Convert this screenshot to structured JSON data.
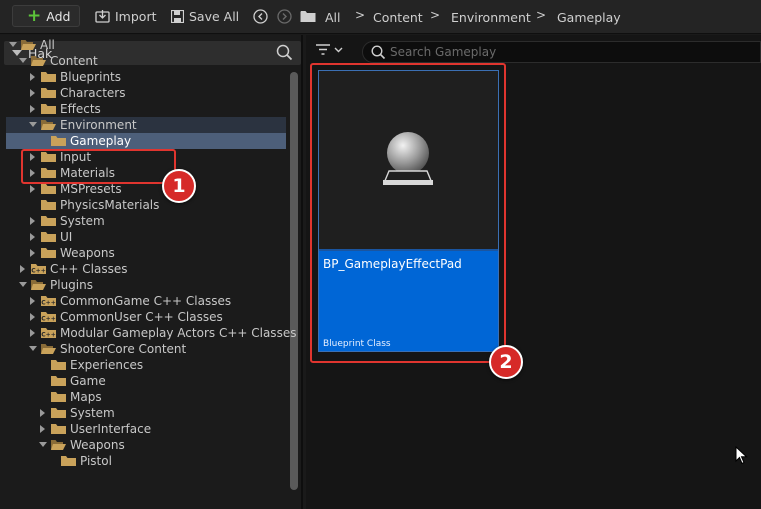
{
  "toolbar": {
    "add_label": "Add",
    "import_label": "Import",
    "save_all_label": "Save All",
    "breadcrumbs": [
      "All",
      "Content",
      "Environment",
      "Gameplay"
    ]
  },
  "sources_panel": {
    "title": "Hak",
    "tree": [
      {
        "label": "All",
        "expanded": true,
        "icon": "folder-open-icon"
      },
      {
        "label": "Content",
        "expanded": true,
        "icon": "folder-open-icon"
      },
      {
        "label": "Blueprints",
        "expanded": false,
        "icon": "folder-icon"
      },
      {
        "label": "Characters",
        "expanded": false,
        "icon": "folder-icon"
      },
      {
        "label": "Effects",
        "expanded": false,
        "icon": "folder-icon"
      },
      {
        "label": "Environment",
        "expanded": true,
        "icon": "folder-open-icon"
      },
      {
        "label": "Gameplay",
        "selected": true,
        "icon": "folder-icon"
      },
      {
        "label": "Input",
        "expanded": false,
        "icon": "folder-icon"
      },
      {
        "label": "Materials",
        "expanded": false,
        "icon": "folder-icon"
      },
      {
        "label": "MSPresets",
        "expanded": false,
        "icon": "folder-icon"
      },
      {
        "label": "PhysicsMaterials",
        "icon": "folder-icon"
      },
      {
        "label": "System",
        "expanded": false,
        "icon": "folder-icon"
      },
      {
        "label": "UI",
        "expanded": false,
        "icon": "folder-icon"
      },
      {
        "label": "Weapons",
        "expanded": false,
        "icon": "folder-icon"
      },
      {
        "label": "C++ Classes",
        "expanded": false,
        "icon": "cpp-folder-icon"
      },
      {
        "label": "Plugins",
        "expanded": true,
        "icon": "folder-open-icon"
      },
      {
        "label": "CommonGame C++ Classes",
        "expanded": false,
        "icon": "cpp-folder-icon"
      },
      {
        "label": "CommonUser C++ Classes",
        "expanded": false,
        "icon": "cpp-folder-icon"
      },
      {
        "label": "Modular Gameplay Actors C++ Classes",
        "expanded": false,
        "icon": "cpp-folder-icon"
      },
      {
        "label": "ShooterCore Content",
        "expanded": true,
        "icon": "folder-open-icon"
      },
      {
        "label": "Experiences",
        "icon": "folder-icon"
      },
      {
        "label": "Game",
        "icon": "folder-icon"
      },
      {
        "label": "Maps",
        "icon": "folder-icon"
      },
      {
        "label": "System",
        "expanded": false,
        "icon": "folder-icon"
      },
      {
        "label": "UserInterface",
        "expanded": false,
        "icon": "folder-icon"
      },
      {
        "label": "Weapons",
        "expanded": true,
        "icon": "folder-open-icon"
      },
      {
        "label": "Pistol",
        "icon": "folder-icon"
      }
    ]
  },
  "content_panel": {
    "search_placeholder": "Search Gameplay",
    "asset": {
      "name": "BP_GameplayEffectPad",
      "type": "Blueprint Class",
      "icon": "sphere-actor-icon"
    }
  },
  "annotations": {
    "badge1": "1",
    "badge2": "2",
    "color": "#e0352f"
  },
  "colors": {
    "selection": "#4d5f7a",
    "asset_tile": "#0066d6",
    "folder": "#c9a25a",
    "add_plus": "#5cc43a"
  }
}
